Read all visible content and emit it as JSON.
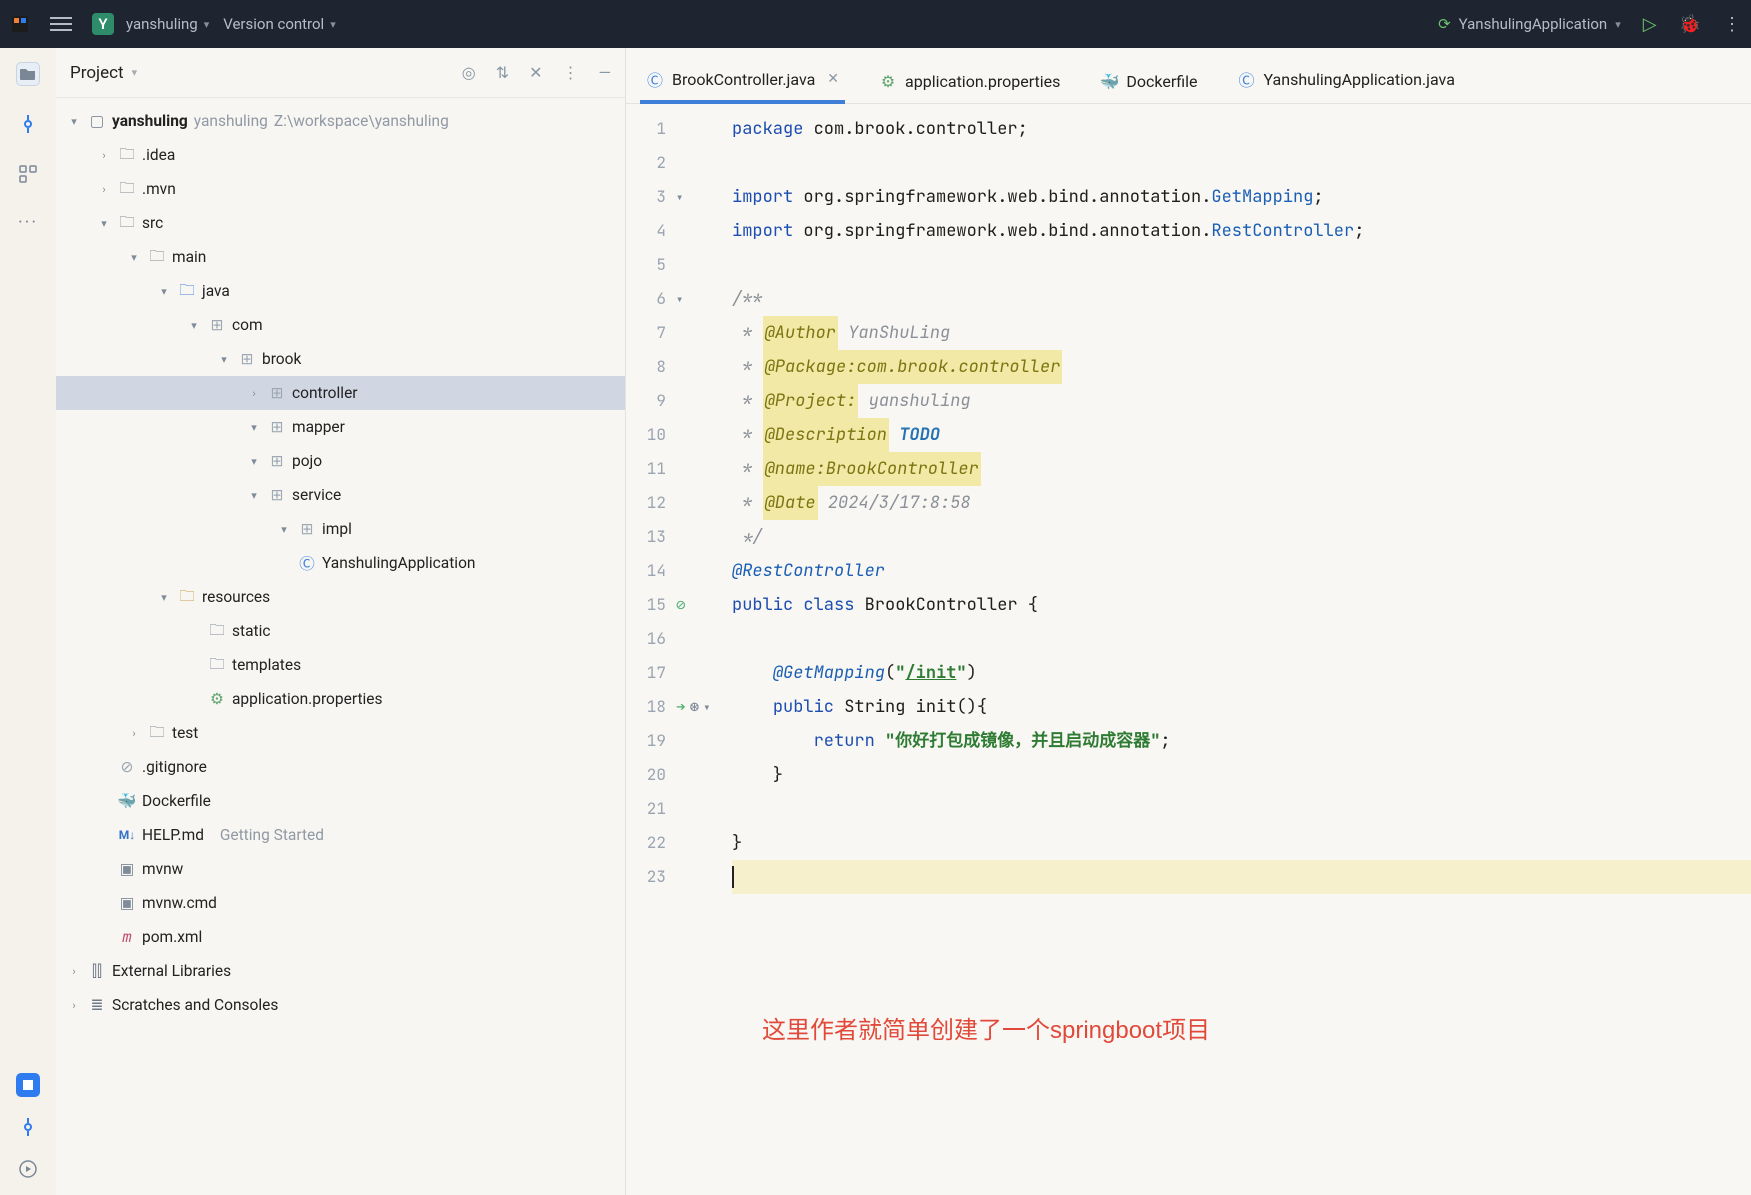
{
  "titlebar": {
    "project_letter": "Y",
    "project_name": "yanshuling",
    "vcs_label": "Version control",
    "run_config": "YanshulingApplication"
  },
  "project_panel": {
    "title": "Project",
    "root": {
      "name": "yanshuling",
      "subtitle": "yanshuling",
      "path": "Z:\\workspace\\yanshuling"
    },
    "nodes": {
      "idea": ".idea",
      "mvn": ".mvn",
      "src": "src",
      "main": "main",
      "java": "java",
      "com": "com",
      "brook": "brook",
      "controller": "controller",
      "mapper": "mapper",
      "pojo": "pojo",
      "service": "service",
      "impl": "impl",
      "app_class": "YanshulingApplication",
      "resources": "resources",
      "static": "static",
      "templates": "templates",
      "app_props": "application.properties",
      "test": "test",
      "gitignore": ".gitignore",
      "dockerfile": "Dockerfile",
      "helpmd": "HELP.md",
      "helpmd_sub": "Getting Started",
      "mvnw": "mvnw",
      "mvnwcmd": "mvnw.cmd",
      "pom": "pom.xml",
      "extlib": "External Libraries",
      "scratch": "Scratches and Consoles"
    }
  },
  "tabs": [
    {
      "label": "BrookController.java",
      "icon": "java",
      "active": true,
      "closeable": true
    },
    {
      "label": "application.properties",
      "icon": "gear",
      "active": false
    },
    {
      "label": "Dockerfile",
      "icon": "docker",
      "active": false
    },
    {
      "label": "YanshulingApplication.java",
      "icon": "java",
      "active": false
    }
  ],
  "code": {
    "lines": [
      {
        "n": 1,
        "t": "package",
        "parts": [
          [
            "kw",
            "package "
          ],
          [
            "ident",
            "com.brook.controller;"
          ]
        ]
      },
      {
        "n": 2,
        "t": "blank"
      },
      {
        "n": 3,
        "t": "import",
        "fold": true,
        "parts": [
          [
            "kw",
            "import "
          ],
          [
            "ident",
            "org.springframework.web.bind.annotation."
          ],
          [
            "cls",
            "GetMapping"
          ],
          [
            "ident",
            ";"
          ]
        ]
      },
      {
        "n": 4,
        "t": "import",
        "parts": [
          [
            "kw",
            "import "
          ],
          [
            "ident",
            "org.springframework.web.bind.annotation."
          ],
          [
            "cls",
            "RestController"
          ],
          [
            "ident",
            ";"
          ]
        ]
      },
      {
        "n": 5,
        "t": "blank"
      },
      {
        "n": 6,
        "t": "doc",
        "fold": true,
        "parts": [
          [
            "cm",
            "/**"
          ]
        ]
      },
      {
        "n": 7,
        "t": "doc",
        "parts": [
          [
            "cm",
            " * "
          ],
          [
            "an-y",
            "@Author"
          ],
          [
            "cm",
            " YanShuLing"
          ]
        ]
      },
      {
        "n": 8,
        "t": "doc",
        "parts": [
          [
            "cm",
            " * "
          ],
          [
            "an-y",
            "@Package:com.brook.controller"
          ]
        ]
      },
      {
        "n": 9,
        "t": "doc",
        "parts": [
          [
            "cm",
            " * "
          ],
          [
            "an-y",
            "@Project:"
          ],
          [
            "cm",
            " yanshuling"
          ]
        ]
      },
      {
        "n": 10,
        "t": "doc",
        "parts": [
          [
            "cm",
            " * "
          ],
          [
            "an-y",
            "@Description"
          ],
          [
            "cm",
            " "
          ],
          [
            "todo",
            "TODO"
          ]
        ]
      },
      {
        "n": 11,
        "t": "doc",
        "parts": [
          [
            "cm",
            " * "
          ],
          [
            "an-y",
            "@name:BrookController"
          ]
        ]
      },
      {
        "n": 12,
        "t": "doc",
        "parts": [
          [
            "cm",
            " * "
          ],
          [
            "an-y",
            "@Date"
          ],
          [
            "cm",
            " 2024/3/17:8:58"
          ]
        ]
      },
      {
        "n": 13,
        "t": "doc",
        "parts": [
          [
            "cm",
            " */"
          ]
        ]
      },
      {
        "n": 14,
        "t": "ann",
        "parts": [
          [
            "an-blue",
            "@RestController"
          ]
        ]
      },
      {
        "n": 15,
        "t": "cls",
        "g": "nosmoke",
        "parts": [
          [
            "kw",
            "public class "
          ],
          [
            "ident",
            "BrookController {"
          ]
        ]
      },
      {
        "n": 16,
        "t": "blank"
      },
      {
        "n": 17,
        "t": "ann2",
        "parts": [
          [
            "ident",
            "    "
          ],
          [
            "an-blue",
            "@GetMapping"
          ],
          [
            "ident",
            "("
          ],
          [
            "str",
            "\""
          ],
          [
            "str ul",
            "/init"
          ],
          [
            "str",
            "\""
          ],
          [
            "ident",
            ")"
          ]
        ]
      },
      {
        "n": 18,
        "t": "meth",
        "g": "run",
        "fold": true,
        "parts": [
          [
            "ident",
            "    "
          ],
          [
            "kw",
            "public "
          ],
          [
            "ident",
            "String init(){"
          ]
        ]
      },
      {
        "n": 19,
        "t": "ret",
        "parts": [
          [
            "ident",
            "        "
          ],
          [
            "kw",
            "return "
          ],
          [
            "str",
            "\"你好打包成镜像，并且启动成容器\""
          ],
          [
            "ident",
            ";"
          ]
        ]
      },
      {
        "n": 20,
        "t": "blank",
        "parts": [
          [
            "ident",
            "    }"
          ]
        ]
      },
      {
        "n": 21,
        "t": "blank"
      },
      {
        "n": 22,
        "t": "end",
        "parts": [
          [
            "ident",
            "}"
          ]
        ]
      },
      {
        "n": 23,
        "t": "caret",
        "hl": true
      }
    ]
  },
  "annotation": "这里作者就简单创建了一个springboot项目"
}
